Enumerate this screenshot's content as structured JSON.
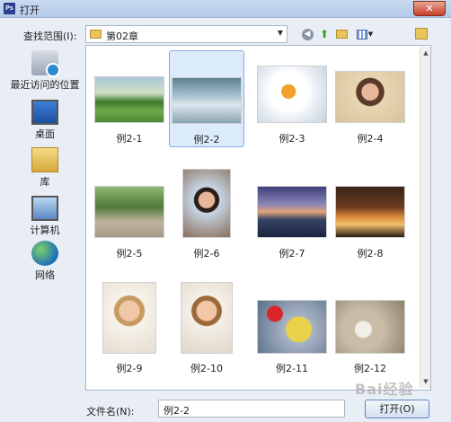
{
  "window": {
    "title": "打开",
    "app_icon": "Ps",
    "close": "✕"
  },
  "lookin": {
    "label": "查找范围(I):",
    "value": "第02章"
  },
  "places": [
    {
      "label": "最近访问的位置",
      "icon": "recent-places-icon"
    },
    {
      "label": "桌面",
      "icon": "desktop-icon"
    },
    {
      "label": "库",
      "icon": "libraries-icon"
    },
    {
      "label": "计算机",
      "icon": "computer-icon"
    },
    {
      "label": "网络",
      "icon": "network-icon"
    }
  ],
  "files": [
    {
      "label": "例2-1"
    },
    {
      "label": "例2-2"
    },
    {
      "label": "例2-3"
    },
    {
      "label": "例2-4"
    },
    {
      "label": "例2-5"
    },
    {
      "label": "例2-6"
    },
    {
      "label": "例2-7"
    },
    {
      "label": "例2-8"
    },
    {
      "label": "例2-9"
    },
    {
      "label": "例2-10"
    },
    {
      "label": "例2-11"
    },
    {
      "label": "例2-12"
    }
  ],
  "selected_file": "例2-2",
  "filename": {
    "label": "文件名(N):",
    "value": "例2-2"
  },
  "open_button": "打开(O)",
  "watermark": "Bai经验"
}
